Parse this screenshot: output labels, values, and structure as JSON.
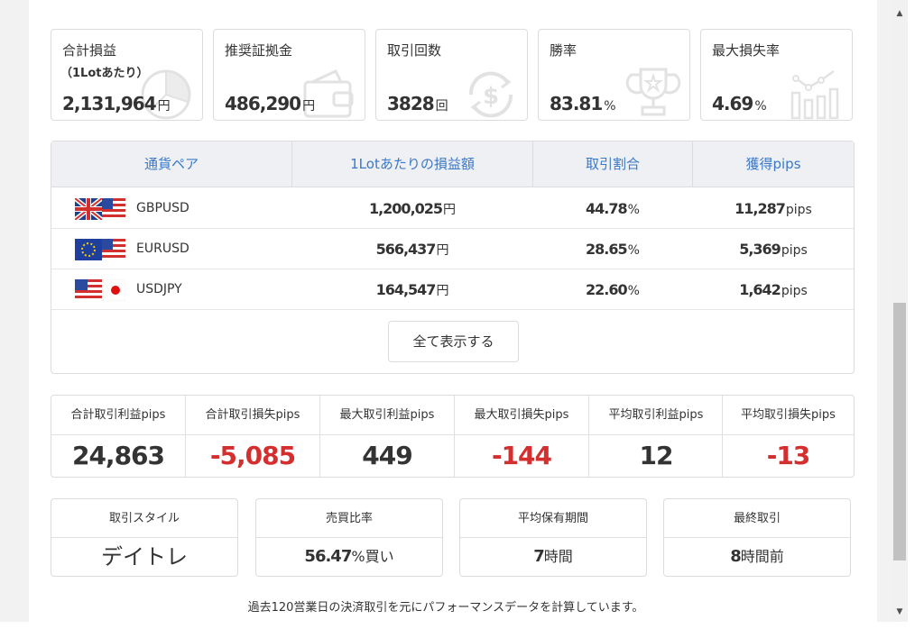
{
  "stats": [
    {
      "label": "合計損益",
      "sub": "（1Lotあたり）",
      "value": "2,131,964",
      "unit": "円",
      "icon": "pie-chart-icon"
    },
    {
      "label": "推奨証拠金",
      "sub": "",
      "value": "486,290",
      "unit": "円",
      "icon": "wallet-icon"
    },
    {
      "label": "取引回数",
      "sub": "",
      "value": "3828",
      "unit": "回",
      "icon": "dollar-exchange-icon"
    },
    {
      "label": "勝率",
      "sub": "",
      "value": "83.81",
      "unit": "%",
      "icon": "trophy-icon"
    },
    {
      "label": "最大損失率",
      "sub": "",
      "value": "4.69",
      "unit": "%",
      "icon": "bar-chart-icon"
    }
  ],
  "table": {
    "headers": [
      "通貨ペア",
      "1Lotあたりの損益額",
      "取引割合",
      "獲得pips"
    ],
    "rows": [
      {
        "pair": "GBPUSD",
        "flag": "gb-us-flag-icon",
        "profit": "1,200,025",
        "profit_unit": "円",
        "ratio": "44.78",
        "ratio_unit": "%",
        "pips": "11,287",
        "pips_unit": "pips"
      },
      {
        "pair": "EURUSD",
        "flag": "eu-us-flag-icon",
        "profit": "566,437",
        "profit_unit": "円",
        "ratio": "28.65",
        "ratio_unit": "%",
        "pips": "5,369",
        "pips_unit": "pips"
      },
      {
        "pair": "USDJPY",
        "flag": "us-jp-flag-icon",
        "profit": "164,547",
        "profit_unit": "円",
        "ratio": "22.60",
        "ratio_unit": "%",
        "pips": "1,642",
        "pips_unit": "pips"
      }
    ],
    "show_all": "全て表示する"
  },
  "pips_summary": [
    {
      "label": "合計取引利益pips",
      "value": "24,863",
      "negative": false
    },
    {
      "label": "合計取引損失pips",
      "value": "-5,085",
      "negative": true
    },
    {
      "label": "最大取引利益pips",
      "value": "449",
      "negative": false
    },
    {
      "label": "最大取引損失pips",
      "value": "-144",
      "negative": true
    },
    {
      "label": "平均取引利益pips",
      "value": "12",
      "negative": false
    },
    {
      "label": "平均取引損失pips",
      "value": "-13",
      "negative": true
    }
  ],
  "info": {
    "style": {
      "label": "取引スタイル",
      "value": "デイトレ"
    },
    "ratio": {
      "label": "売買比率",
      "value": "56.47",
      "unit": "%買い"
    },
    "holding": {
      "label": "平均保有期間",
      "value": "7",
      "unit": "時間"
    },
    "last": {
      "label": "最終取引",
      "value": "8",
      "unit": "時間前"
    }
  },
  "footnote": "過去120営業日の決済取引を元にパフォーマンスデータを計算しています。",
  "colors": {
    "header_text": "#3a78c9",
    "negative": "#d32f2f",
    "border": "#dcdcdc",
    "header_bg": "#eef0f3"
  }
}
